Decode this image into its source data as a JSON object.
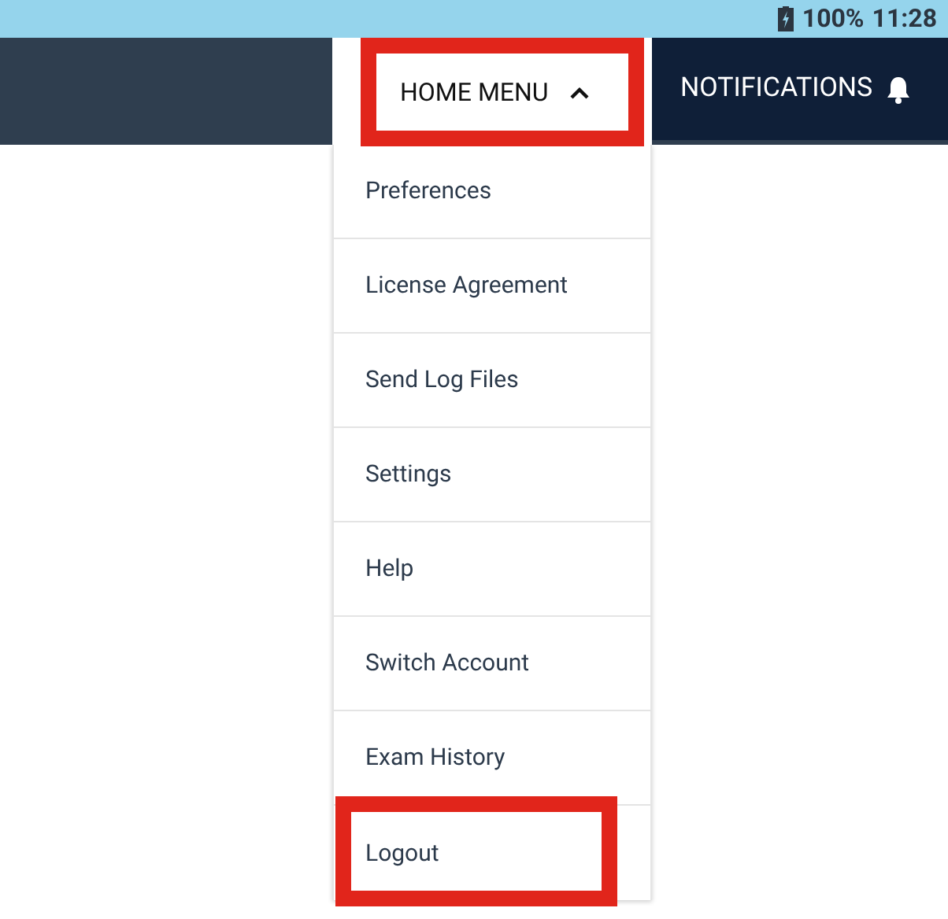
{
  "status_bar": {
    "battery": "100%",
    "time": "11:28"
  },
  "header": {
    "home_menu": {
      "label": "HOME MENU",
      "expanded": true,
      "highlighted": true
    },
    "notifications": {
      "label": "NOTIFICATIONS"
    }
  },
  "menu": {
    "items": [
      {
        "label": "Preferences",
        "highlighted": false
      },
      {
        "label": "License Agreement",
        "highlighted": false
      },
      {
        "label": "Send Log Files",
        "highlighted": false
      },
      {
        "label": "Settings",
        "highlighted": false
      },
      {
        "label": "Help",
        "highlighted": false
      },
      {
        "label": "Switch Account",
        "highlighted": false
      },
      {
        "label": "Exam History",
        "highlighted": false
      },
      {
        "label": "Logout",
        "highlighted": true
      }
    ]
  }
}
